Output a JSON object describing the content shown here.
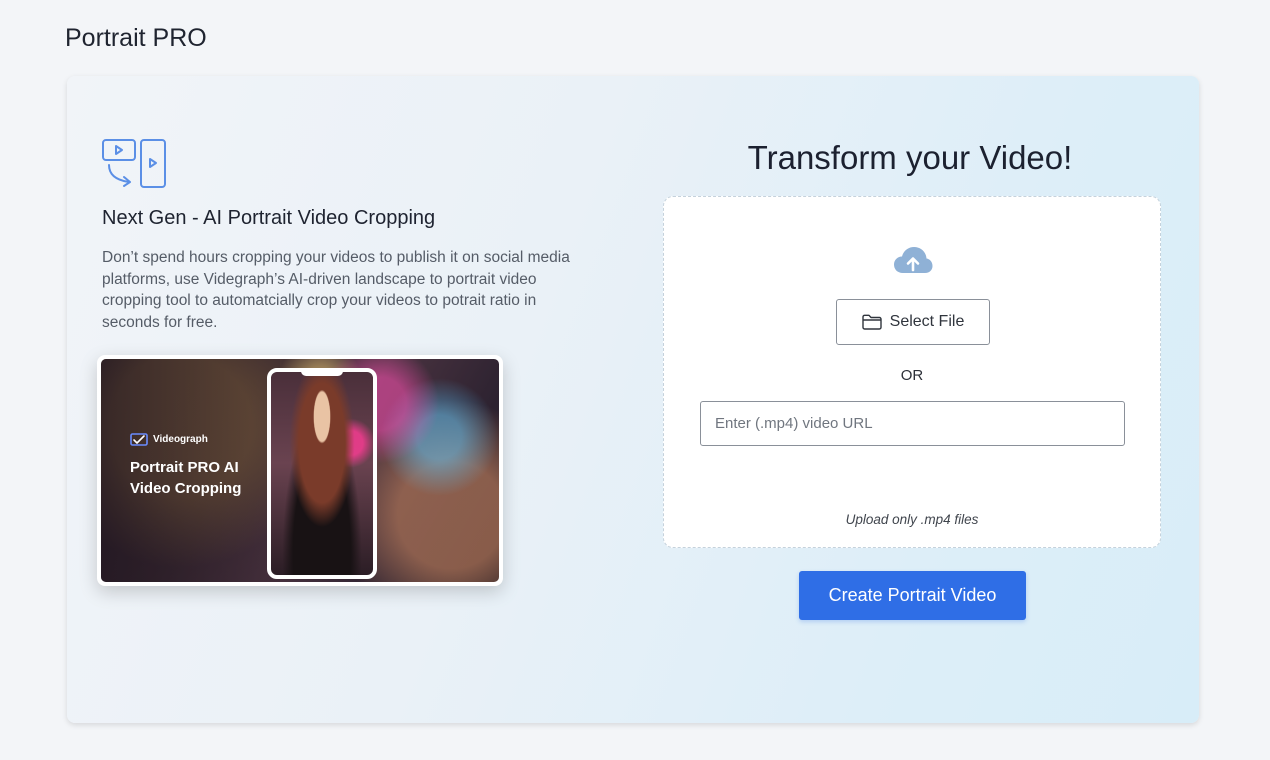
{
  "page": {
    "title": "Portrait PRO"
  },
  "intro": {
    "headline": "Next Gen - AI  Portrait Video Cropping",
    "description": "Don’t spend hours cropping your videos to publish it on social media platforms, use Videgraph’s AI-driven landscape to portrait video cropping tool to automatcially crop your videos to potrait ratio in seconds for free.",
    "feature_icon": "landscape-to-portrait-icon"
  },
  "preview": {
    "brand": "Videograph",
    "title": "Portrait PRO AI Video Cropping"
  },
  "upload": {
    "title": "Transform your Video!",
    "cloud_icon": "cloud-upload-icon",
    "select_file_label": "Select File",
    "folder_icon": "folder-icon",
    "or_label": "OR",
    "url_input": {
      "placeholder": "Enter (.mp4) video URL",
      "value": ""
    },
    "hint": "Upload only .mp4 files"
  },
  "actions": {
    "create_label": "Create Portrait Video"
  },
  "colors": {
    "accent": "#2f6ee6",
    "icon_blue": "#5b8fe6",
    "cloud": "#8fb1d6"
  }
}
